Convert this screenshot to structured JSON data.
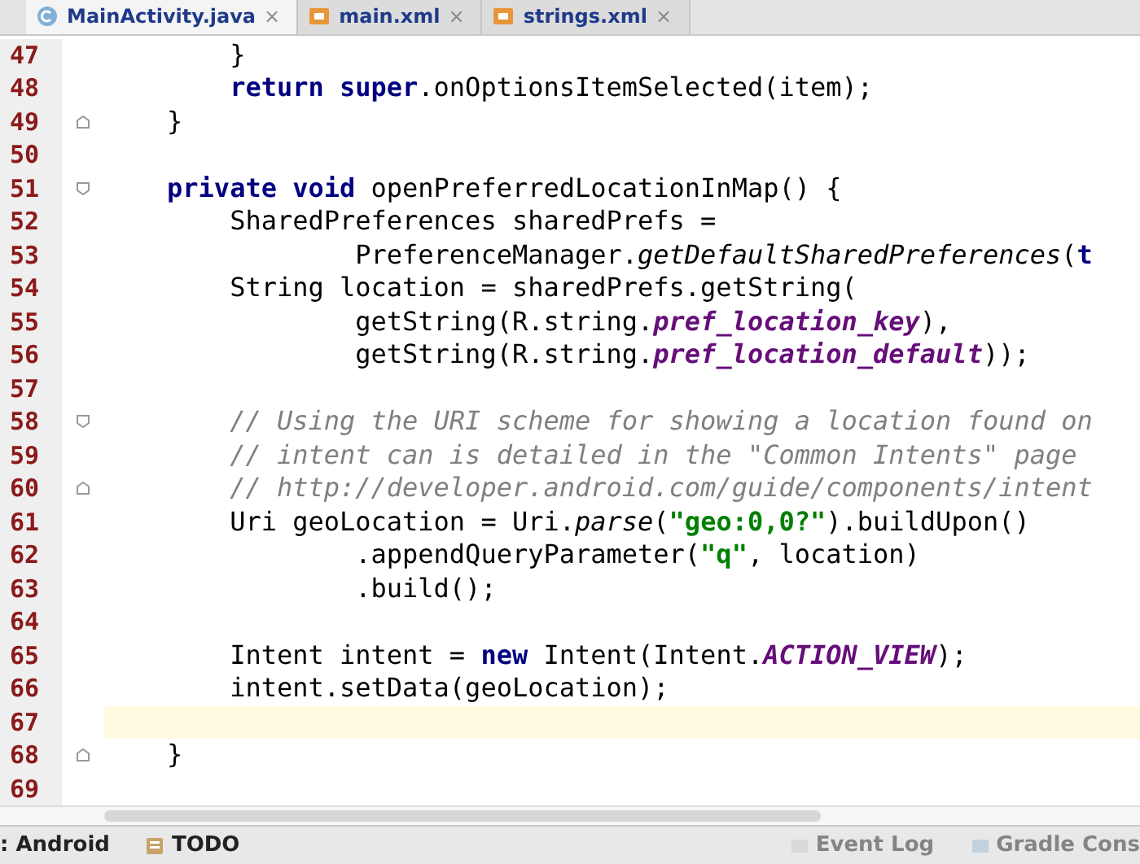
{
  "tabs": [
    {
      "label": "MainActivity.java",
      "kind": "java",
      "selected": true,
      "close": "×"
    },
    {
      "label": "main.xml",
      "kind": "xml",
      "selected": false,
      "close": "×"
    },
    {
      "label": "strings.xml",
      "kind": "xml",
      "selected": false,
      "close": "×"
    }
  ],
  "lines": [
    {
      "number": "47",
      "current": false,
      "segments": [
        {
          "kind": "plain",
          "text": "        }"
        }
      ]
    },
    {
      "number": "48",
      "current": false,
      "segments": [
        {
          "kind": "keyword",
          "text": "        return super"
        },
        {
          "kind": "plain",
          "text": ".onOptionsItemSelected(item);"
        }
      ]
    },
    {
      "number": "49",
      "current": false,
      "fold_end": true,
      "segments": [
        {
          "kind": "plain",
          "text": "    }"
        }
      ]
    },
    {
      "number": "50",
      "current": false
    },
    {
      "number": "51",
      "current": false,
      "fold_start": true,
      "segments": [
        {
          "kind": "keyword",
          "text": "    private void"
        },
        {
          "kind": "plain",
          "text": " openPreferredLocationInMap() {"
        }
      ]
    },
    {
      "number": "52",
      "current": false,
      "segments": [
        {
          "kind": "plain",
          "text": "        SharedPreferences sharedPrefs ="
        }
      ]
    },
    {
      "number": "53",
      "current": false,
      "segments": [
        {
          "kind": "plain",
          "text": "                PreferenceManager."
        },
        {
          "kind": "static",
          "text": "getDefaultSharedPreferences"
        },
        {
          "kind": "plain",
          "text": "("
        },
        {
          "kind": "keyword",
          "text": "t"
        }
      ]
    },
    {
      "number": "54",
      "current": false,
      "segments": [
        {
          "kind": "plain",
          "text": "        String location = sharedPrefs.getString("
        }
      ]
    },
    {
      "number": "55",
      "current": false,
      "segments": [
        {
          "kind": "plain",
          "text": "                getString(R.string."
        },
        {
          "kind": "field",
          "text": "pref_location_key"
        },
        {
          "kind": "plain",
          "text": "),"
        }
      ]
    },
    {
      "number": "56",
      "current": false,
      "segments": [
        {
          "kind": "plain",
          "text": "                getString(R.string."
        },
        {
          "kind": "field",
          "text": "pref_location_default"
        },
        {
          "kind": "plain",
          "text": "));"
        }
      ]
    },
    {
      "number": "57",
      "current": false
    },
    {
      "number": "58",
      "current": false,
      "fold_start": true,
      "segments": [
        {
          "kind": "comment",
          "text": "        // Using the URI scheme for showing a location found on"
        }
      ]
    },
    {
      "number": "59",
      "current": false,
      "segments": [
        {
          "kind": "comment",
          "text": "        // intent can is detailed in the \"Common Intents\" page"
        }
      ]
    },
    {
      "number": "60",
      "current": false,
      "fold_end": true,
      "segments": [
        {
          "kind": "comment",
          "text": "        // http://developer.android.com/guide/components/intent"
        }
      ]
    },
    {
      "number": "61",
      "current": false,
      "segments": [
        {
          "kind": "plain",
          "text": "        Uri geoLocation = Uri."
        },
        {
          "kind": "static",
          "text": "parse"
        },
        {
          "kind": "plain",
          "text": "("
        },
        {
          "kind": "string",
          "text": "\"geo:0,0?\""
        },
        {
          "kind": "plain",
          "text": ").buildUpon()"
        }
      ]
    },
    {
      "number": "62",
      "current": false,
      "segments": [
        {
          "kind": "plain",
          "text": "                .appendQueryParameter("
        },
        {
          "kind": "string",
          "text": "\"q\""
        },
        {
          "kind": "plain",
          "text": ", location)"
        }
      ]
    },
    {
      "number": "63",
      "current": false,
      "segments": [
        {
          "kind": "plain",
          "text": "                .build();"
        }
      ]
    },
    {
      "number": "64",
      "current": false
    },
    {
      "number": "65",
      "current": false,
      "segments": [
        {
          "kind": "plain",
          "text": "        Intent intent = "
        },
        {
          "kind": "keyword",
          "text": "new"
        },
        {
          "kind": "plain",
          "text": " Intent(Intent."
        },
        {
          "kind": "field",
          "text": "ACTION_VIEW"
        },
        {
          "kind": "plain",
          "text": ");"
        }
      ]
    },
    {
      "number": "66",
      "current": false,
      "segments": [
        {
          "kind": "plain",
          "text": "        intent.setData(geoLocation);"
        }
      ]
    },
    {
      "number": "67",
      "current": true
    },
    {
      "number": "68",
      "current": false,
      "fold_end": true,
      "segments": [
        {
          "kind": "plain",
          "text": "    }"
        }
      ]
    },
    {
      "number": "69",
      "current": false
    }
  ],
  "status_bar": [
    {
      "label": ": Android",
      "kind": "android"
    },
    {
      "label": "TODO",
      "kind": "todo"
    },
    {
      "label": "Event Log",
      "kind": "log"
    },
    {
      "label": "Gradle Cons",
      "kind": "gradle"
    }
  ]
}
